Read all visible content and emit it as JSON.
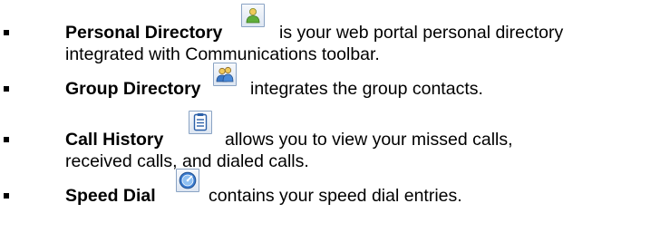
{
  "items": [
    {
      "term": "Personal Directory",
      "icon": "personal-directory-icon",
      "line1": "is your web portal personal directory",
      "line2": "integrated with Communications toolbar."
    },
    {
      "term": "Group Directory",
      "icon": "group-directory-icon",
      "line1": "integrates the group contacts."
    },
    {
      "term": "Call History",
      "icon": "call-history-icon",
      "line1": "allows you to view your missed calls,",
      "line2": "received calls, and dialed calls."
    },
    {
      "term": "Speed Dial",
      "icon": "speed-dial-icon",
      "line1": "contains your speed dial entries."
    }
  ]
}
